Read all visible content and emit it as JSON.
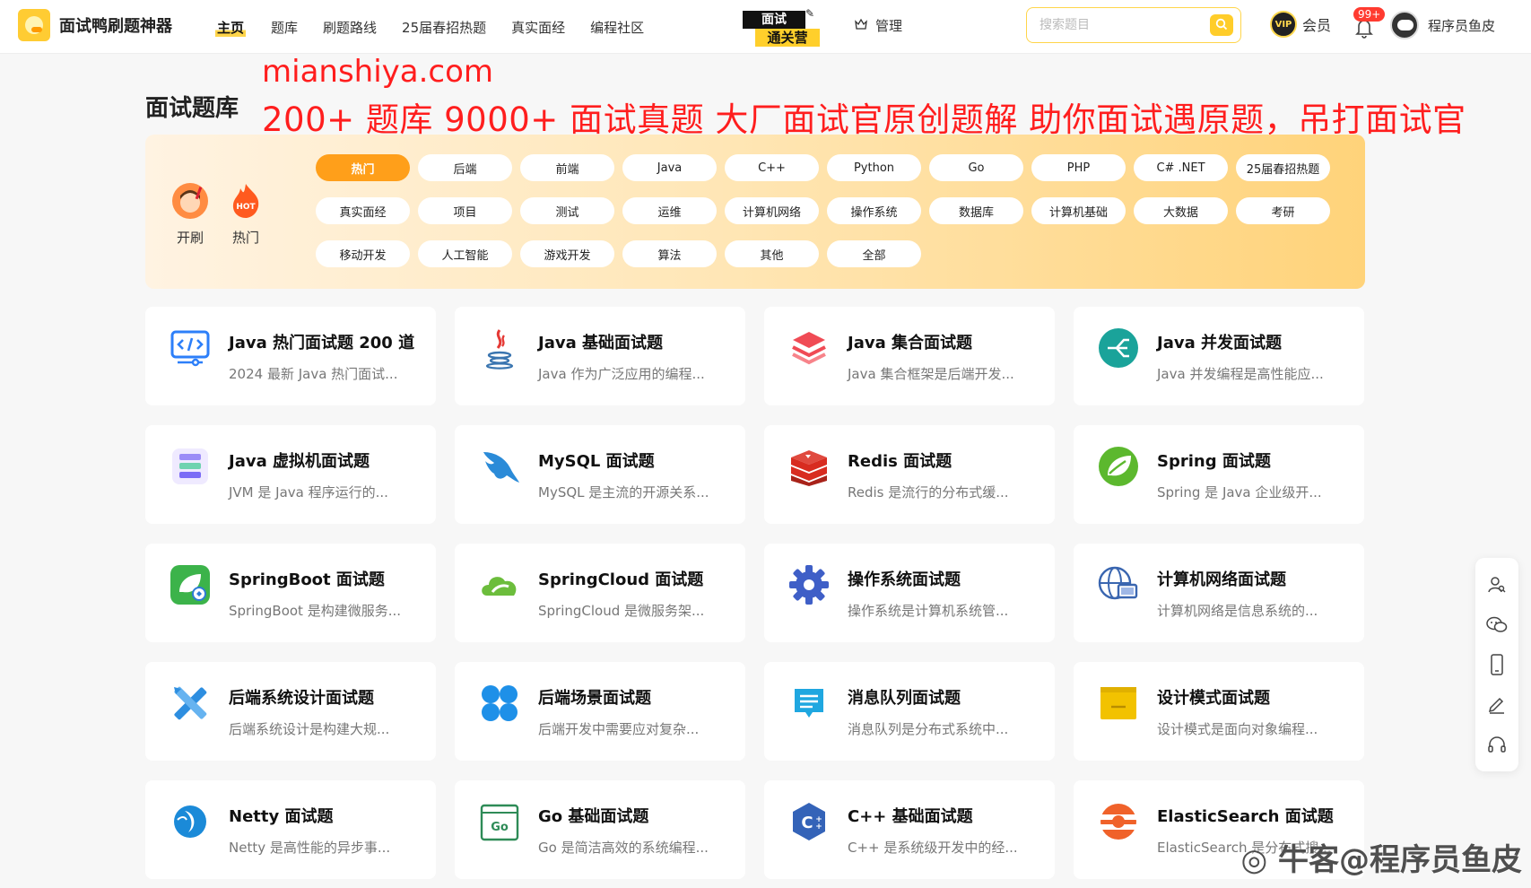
{
  "app": {
    "name": "面试鸭刷题神器"
  },
  "nav": {
    "items": [
      {
        "label": "主页",
        "active": true
      },
      {
        "label": "题库"
      },
      {
        "label": "刷题路线"
      },
      {
        "label": "25届春招热题"
      },
      {
        "label": "真实面经"
      },
      {
        "label": "编程社区"
      }
    ],
    "promo": {
      "top": "面试",
      "bottom": "通关营"
    },
    "admin": "管理",
    "search_placeholder": "搜索题目",
    "vip_label": "会员",
    "vip_badge": "VIP",
    "notification_count": "99+",
    "user_name": "程序员鱼皮"
  },
  "header": {
    "title": "面试题库",
    "overlay_site": "mianshiya.com",
    "overlay_slogan": "200+ 题库  9000+ 面试真题  大厂面试官原创题解  助你面试遇原题，吊打面试官"
  },
  "quick": [
    {
      "label": "开刷",
      "icon": "boy-avatar-icon"
    },
    {
      "label": "热门",
      "icon": "hot-flame-icon"
    }
  ],
  "tags": [
    {
      "label": "热门",
      "active": true
    },
    {
      "label": "后端"
    },
    {
      "label": "前端"
    },
    {
      "label": "Java"
    },
    {
      "label": "C++"
    },
    {
      "label": "Python"
    },
    {
      "label": "Go"
    },
    {
      "label": "PHP"
    },
    {
      "label": "C# .NET"
    },
    {
      "label": "25届春招热题"
    },
    {
      "label": "真实面经"
    },
    {
      "label": "项目"
    },
    {
      "label": "测试"
    },
    {
      "label": "运维"
    },
    {
      "label": "计算机网络"
    },
    {
      "label": "操作系统"
    },
    {
      "label": "数据库"
    },
    {
      "label": "计算机基础"
    },
    {
      "label": "大数据"
    },
    {
      "label": "考研"
    },
    {
      "label": "移动开发"
    },
    {
      "label": "人工智能"
    },
    {
      "label": "游戏开发"
    },
    {
      "label": "算法"
    },
    {
      "label": "其他"
    },
    {
      "label": "全部"
    }
  ],
  "banks": [
    {
      "title": "Java 热门面试题 200 道",
      "desc": "2024 最新 Java 热门面试...",
      "icon": "code-monitor-icon",
      "color": "#2d7ff9"
    },
    {
      "title": "Java 基础面试题",
      "desc": "Java 作为广泛应用的编程...",
      "icon": "java-cup-icon",
      "color": "#e76f00"
    },
    {
      "title": "Java 集合面试题",
      "desc": "Java 集合框架是后端开发...",
      "icon": "layers-icon",
      "color": "#f04b55"
    },
    {
      "title": "Java 并发面试题",
      "desc": "Java 并发编程是高性能应...",
      "icon": "branch-circle-icon",
      "color": "#1aa39a"
    },
    {
      "title": "Java 虚拟机面试题",
      "desc": "JVM 是 Java 程序运行的...",
      "icon": "server-stack-icon",
      "color": "#7b6cf6"
    },
    {
      "title": "MySQL 面试题",
      "desc": "MySQL 是主流的开源关系...",
      "icon": "dolphin-icon",
      "color": "#2b8bd8"
    },
    {
      "title": "Redis 面试题",
      "desc": "Redis 是流行的分布式缓...",
      "icon": "redis-cube-icon",
      "color": "#d82c20"
    },
    {
      "title": "Spring 面试题",
      "desc": "Spring 是 Java 企业级开...",
      "icon": "spring-leaf-icon",
      "color": "#5cb82e"
    },
    {
      "title": "SpringBoot 面试题",
      "desc": "SpringBoot 是构建微服务...",
      "icon": "springboot-icon",
      "color": "#3cb34a"
    },
    {
      "title": "SpringCloud 面试题",
      "desc": "SpringCloud 是微服务架...",
      "icon": "cloud-leaf-icon",
      "color": "#6cbd3c"
    },
    {
      "title": "操作系统面试题",
      "desc": "操作系统是计算机系统管...",
      "icon": "gear-icon",
      "color": "#3f5fc7"
    },
    {
      "title": "计算机网络面试题",
      "desc": "计算机网络是信息系统的...",
      "icon": "globe-monitor-icon",
      "color": "#3a66b0"
    },
    {
      "title": "后端系统设计面试题",
      "desc": "后端系统设计是构建大规...",
      "icon": "design-tools-icon",
      "color": "#2d8ee0"
    },
    {
      "title": "后端场景面试题",
      "desc": "后端开发中需要应对复杂...",
      "icon": "four-petal-icon",
      "color": "#1e90e8"
    },
    {
      "title": "消息队列面试题",
      "desc": "消息队列是分布式系统中...",
      "icon": "message-box-icon",
      "color": "#1fa7e0"
    },
    {
      "title": "设计模式面试题",
      "desc": "设计模式是面向对象编程...",
      "icon": "yellow-window-icon",
      "color": "#f2c200"
    },
    {
      "title": "Netty 面试题",
      "desc": "Netty 是高性能的异步事...",
      "icon": "netty-icon",
      "color": "#1b8ad8"
    },
    {
      "title": "Go 基础面试题",
      "desc": "Go 是简洁高效的系统编程...",
      "icon": "go-window-icon",
      "color": "#2e8b57"
    },
    {
      "title": "C++ 基础面试题",
      "desc": "C++ 是系统级开发中的经...",
      "icon": "cpp-hex-icon",
      "color": "#3463b8"
    },
    {
      "title": "ElasticSearch 面试题",
      "desc": "ElasticSearch 是分布式搜...",
      "icon": "elastic-icon",
      "color": "#f0622a"
    }
  ],
  "side_tools": [
    "user-search-icon",
    "wechat-icon",
    "phone-icon",
    "pen-icon",
    "headset-icon"
  ],
  "corner_watermark": "牛客@程序员鱼皮"
}
